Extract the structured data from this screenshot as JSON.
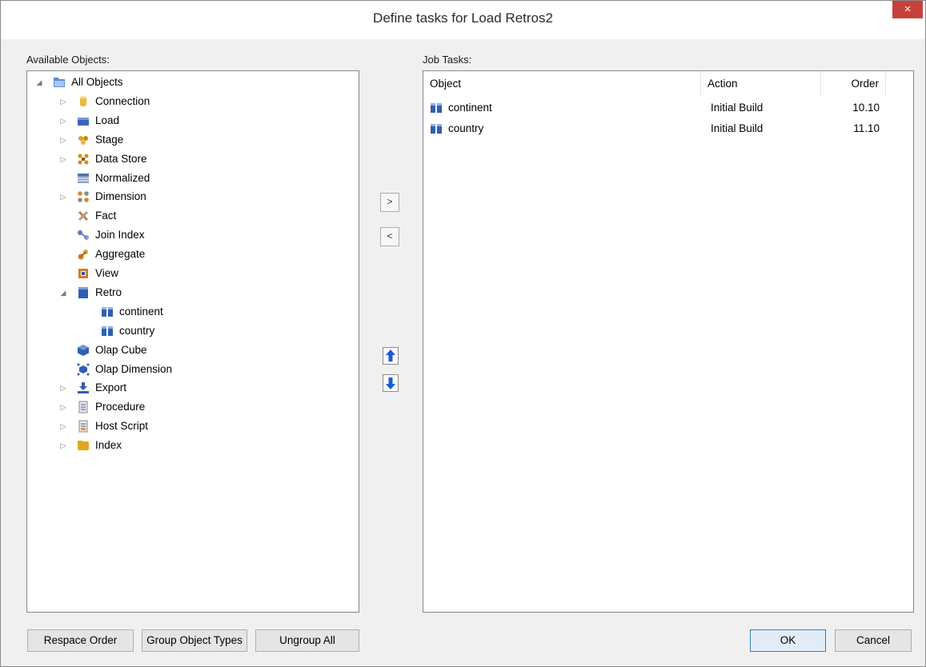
{
  "window": {
    "title": "Define tasks for Load Retros2",
    "close_label": "×"
  },
  "left": {
    "label": "Available Objects:",
    "tree": [
      {
        "label": "All Objects",
        "icon": "folder-icon",
        "expander": "expanded",
        "level": 0
      },
      {
        "label": "Connection",
        "icon": "connection-icon",
        "expander": "collapsed",
        "level": 1
      },
      {
        "label": "Load",
        "icon": "load-table-icon",
        "expander": "collapsed",
        "level": 1
      },
      {
        "label": "Stage",
        "icon": "stage-table-icon",
        "expander": "collapsed",
        "level": 1
      },
      {
        "label": "Data Store",
        "icon": "data-store-icon",
        "expander": "collapsed",
        "level": 1
      },
      {
        "label": "Normalized",
        "icon": "normalized-table-icon",
        "expander": "none",
        "level": 1
      },
      {
        "label": "Dimension",
        "icon": "dimension-icon",
        "expander": "collapsed",
        "level": 1
      },
      {
        "label": "Fact",
        "icon": "fact-table-icon",
        "expander": "none",
        "level": 1
      },
      {
        "label": "Join Index",
        "icon": "join-index-icon",
        "expander": "none",
        "level": 1
      },
      {
        "label": "Aggregate",
        "icon": "aggregate-icon",
        "expander": "none",
        "level": 1
      },
      {
        "label": "View",
        "icon": "view-icon",
        "expander": "none",
        "level": 1
      },
      {
        "label": "Retro",
        "icon": "retro-icon",
        "expander": "expanded",
        "level": 1
      },
      {
        "label": "continent",
        "icon": "retro-table-icon",
        "expander": "none",
        "level": 2
      },
      {
        "label": "country",
        "icon": "retro-table-icon",
        "expander": "none",
        "level": 2
      },
      {
        "label": "Olap Cube",
        "icon": "olap-cube-icon",
        "expander": "none",
        "level": 1
      },
      {
        "label": "Olap Dimension",
        "icon": "olap-dimension-icon",
        "expander": "none",
        "level": 1
      },
      {
        "label": "Export",
        "icon": "export-icon",
        "expander": "collapsed",
        "level": 1
      },
      {
        "label": "Procedure",
        "icon": "procedure-icon",
        "expander": "collapsed",
        "level": 1
      },
      {
        "label": "Host Script",
        "icon": "host-script-icon",
        "expander": "collapsed",
        "level": 1
      },
      {
        "label": "Index",
        "icon": "index-icon",
        "expander": "collapsed",
        "level": 1
      }
    ]
  },
  "middle": {
    "add_label": ">",
    "remove_label": "<",
    "move_up_icon": "arrow-up-icon",
    "move_down_icon": "arrow-down-icon"
  },
  "right": {
    "label": "Job Tasks:",
    "columns": [
      "Object",
      "Action",
      "Order"
    ],
    "rows": [
      {
        "object": "continent",
        "action": "Initial Build",
        "order": "10.10",
        "icon": "retro-table-icon"
      },
      {
        "object": "country",
        "action": "Initial Build",
        "order": "11.10",
        "icon": "retro-table-icon"
      }
    ]
  },
  "footer": {
    "respace_label": "Respace Order",
    "group_label": "Group Object Types",
    "ungroup_label": "Ungroup All",
    "ok_label": "OK",
    "cancel_label": "Cancel"
  },
  "colors": {
    "close": "#c7413a",
    "accent": "#3c7fb1",
    "retro": "#2f5fb3",
    "arrow": "#1a5bd6"
  }
}
